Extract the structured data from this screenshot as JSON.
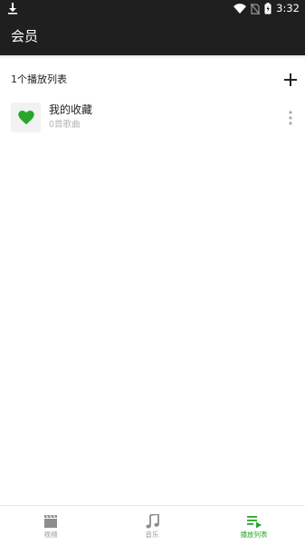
{
  "status_bar": {
    "time": "3:32",
    "icons": [
      "download-icon",
      "wifi-icon",
      "no-sim-icon",
      "battery-icon"
    ]
  },
  "app_bar": {
    "title": "会员"
  },
  "playlist_header": {
    "count_label": "1个播放列表",
    "add_icon": "plus-icon"
  },
  "playlists": [
    {
      "name": "我的收藏",
      "subtitle": "0首歌曲",
      "icon": "heart-icon",
      "menu_icon": "more-vertical-icon"
    }
  ],
  "bottom_nav": {
    "items": [
      {
        "label": "视频",
        "icon": "film-icon",
        "active": false
      },
      {
        "label": "音乐",
        "icon": "music-note-icon",
        "active": false
      },
      {
        "label": "播放列表",
        "icon": "playlist-play-icon",
        "active": true
      }
    ]
  },
  "colors": {
    "app_bar": "#1f1f1f",
    "accent": "#2aa52a",
    "inactive": "#999999"
  }
}
